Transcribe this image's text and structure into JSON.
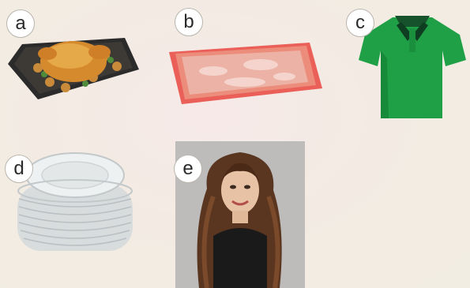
{
  "items": [
    {
      "label": "a",
      "picture": "roast-chicken-tray"
    },
    {
      "label": "b",
      "picture": "packaged-raw-meat"
    },
    {
      "label": "c",
      "picture": "green-polo-shirt"
    },
    {
      "label": "d",
      "picture": "stack-of-white-plates"
    },
    {
      "label": "e",
      "picture": "woman-with-long-curly-hair"
    }
  ],
  "colors": {
    "badge_border": "#b9b5ae",
    "shirt_green": "#1fa046",
    "tray_red": "#e8443c",
    "meat_pink": "#e9a596"
  }
}
